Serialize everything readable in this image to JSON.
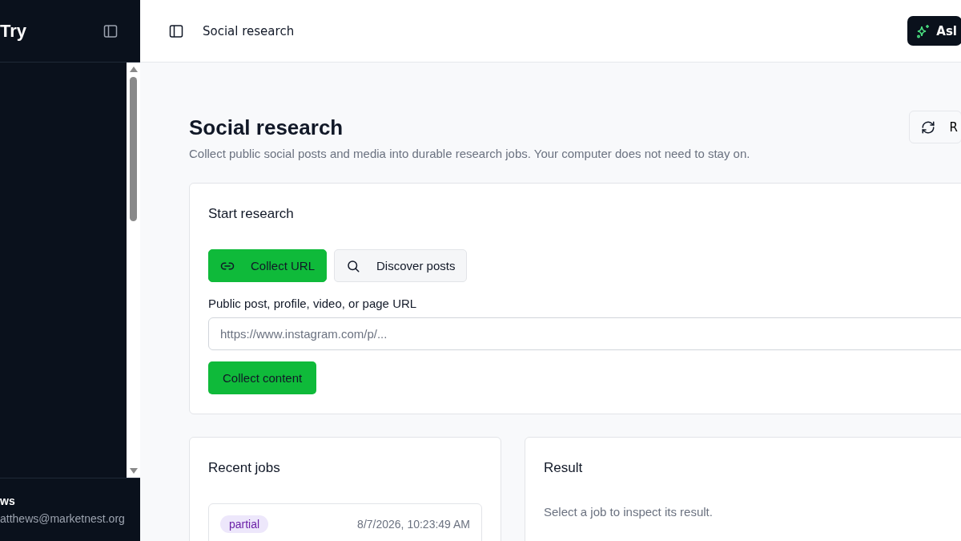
{
  "sidebar": {
    "brand": "Try",
    "user_name": "ws",
    "user_email": "atthews@marketnest.org"
  },
  "header": {
    "title": "Social research",
    "ask_button": "Asl"
  },
  "page": {
    "title": "Social research",
    "subtitle": "Collect public social posts and media into durable research jobs. Your computer does not need to stay on.",
    "refresh_button": "R"
  },
  "start": {
    "title": "Start research",
    "modes": [
      {
        "label": "Collect URL",
        "kind": "link",
        "selected": true
      },
      {
        "label": "Discover posts",
        "kind": "search",
        "selected": false
      }
    ],
    "field_label": "Public post, profile, video, or page URL",
    "placeholder": "https://www.instagram.com/p/...",
    "submit": "Collect content"
  },
  "jobs": {
    "title": "Recent jobs",
    "items": [
      {
        "status": "partial",
        "time": "8/7/2026, 10:23:49 AM"
      }
    ]
  },
  "result": {
    "title": "Result",
    "empty": "Select a job to inspect its result."
  }
}
